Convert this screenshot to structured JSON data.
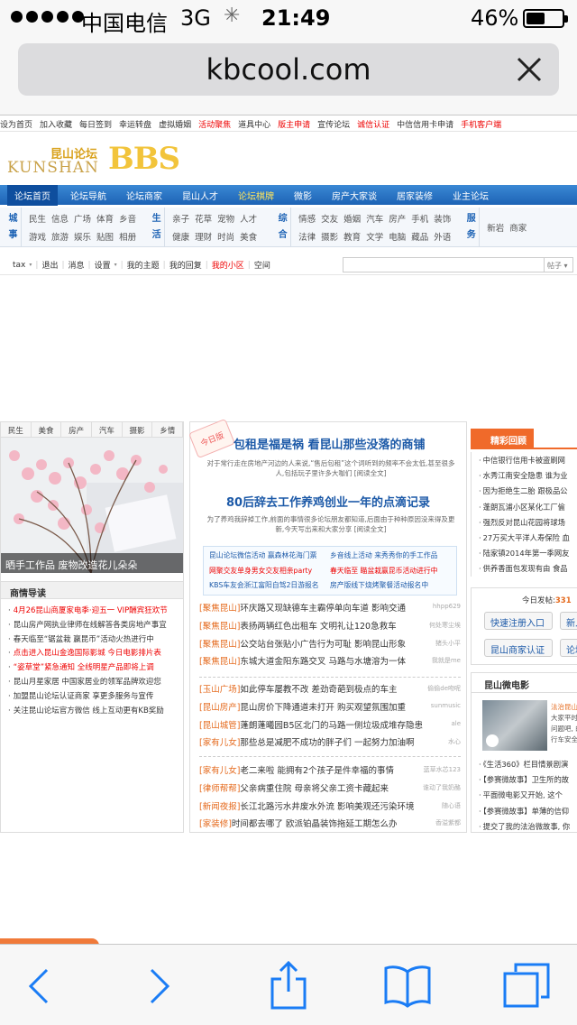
{
  "status": {
    "carrier": "中国电信",
    "network": "3G",
    "time": "21:49",
    "battery": "46%"
  },
  "browser": {
    "url": "kbcool.com"
  },
  "top_links": [
    {
      "t": "设为首页",
      "red": false
    },
    {
      "t": "加入收藏",
      "red": false
    },
    {
      "t": "每日签到",
      "red": false
    },
    {
      "t": "幸运转盘",
      "red": false
    },
    {
      "t": "虚拟婚姻",
      "red": false
    },
    {
      "t": "活动聚焦",
      "red": true
    },
    {
      "t": "道具中心",
      "red": false
    },
    {
      "t": "版主申请",
      "red": true
    },
    {
      "t": "宣传论坛",
      "red": false
    },
    {
      "t": "诚信认证",
      "red": true
    },
    {
      "t": "中信信用卡申请",
      "red": false
    },
    {
      "t": "手机客户端",
      "red": true
    }
  ],
  "logo": {
    "cn": "昆山论坛",
    "en": "KUNSHAN",
    "bbs": "BBS"
  },
  "main_nav": [
    {
      "t": "论坛首页",
      "cls": "first"
    },
    {
      "t": "论坛导航",
      "cls": ""
    },
    {
      "t": "论坛商家",
      "cls": ""
    },
    {
      "t": "昆山人才",
      "cls": ""
    },
    {
      "t": "论坛棋牌",
      "cls": "yel"
    },
    {
      "t": "微影",
      "cls": ""
    },
    {
      "t": "房产大家谈",
      "cls": ""
    },
    {
      "t": "居家装修",
      "cls": ""
    },
    {
      "t": "业主论坛",
      "cls": ""
    }
  ],
  "categories": [
    {
      "head1": "城",
      "head2": "事",
      "links": [
        "民生",
        "信息",
        "广场",
        "体育",
        "乡音",
        "游戏",
        "旅游",
        "娱乐",
        "贴图",
        "相册"
      ]
    },
    {
      "head1": "生",
      "head2": "活",
      "links": [
        "亲子",
        "花草",
        "宠物",
        "人才",
        "",
        "健康",
        "理财",
        "时尚",
        "美食",
        ""
      ]
    },
    {
      "head1": "综",
      "head2": "合",
      "links": [
        "情感",
        "交友",
        "婚姻",
        "汽车",
        "房产",
        "手机",
        "装饰",
        "法律",
        "摄影",
        "教育",
        "文学",
        "电脑",
        "藏品",
        "外语"
      ]
    },
    {
      "head1": "服",
      "head2": "务",
      "links": [
        "新岩",
        "商家"
      ]
    }
  ],
  "user_bar": {
    "items": [
      "tax",
      "退出",
      "消息",
      "设置",
      "我的主题",
      "我的回复",
      "我的小区",
      "空间"
    ],
    "search_btn": "帖子"
  },
  "left": {
    "tabs": [
      "民生",
      "美食",
      "房产",
      "汽车",
      "摄影",
      "乡情"
    ],
    "photo_caption": "晒手工作品 废物改造花儿朵朵",
    "section": "商情导读",
    "items": [
      {
        "t": "4月26昆山商厦家电季·迎五一 VIP酬宾狂欢节",
        "red": true
      },
      {
        "t": "昆山房产网执业律师在线解答各类房地产事宜",
        "red": false
      },
      {
        "t": "春天临至“锯盆栽 赢昆币”活动火热进行中",
        "red": false
      },
      {
        "t": "点击进入昆山金逸国际影城 今日电影排片表",
        "red": true
      },
      {
        "t": "“姿草堂”紧急通知 全线明星产品即将上调",
        "red": true
      },
      {
        "t": "昆山月星家居 中国家居业的领军品牌欢迎您",
        "red": false
      },
      {
        "t": "加盟昆山论坛认证商家 享更多服务与宣传",
        "red": false
      },
      {
        "t": "关注昆山论坛官方微信 线上互动更有KB奖励",
        "red": false
      }
    ]
  },
  "center": {
    "badge": "今日版",
    "headline1": "包租是福是祸 看昆山那些没落的商铺",
    "summary1": "对于常行走在房地产河边的人来说,“售后包租”这个词听到的频率不会太低,甚至很多人,包括玩子里许多大咖们 [阅读全文]",
    "headline2": "80后辞去工作养鸡创业一年的点滴记录",
    "summary2": "为了养鸡我辞掉工作,前面的事情很多论坛朋友都知道,后面由于种种原因没来得及更新,今天写出来和大家分享 [阅读全文]",
    "links": [
      {
        "t": "昆山论坛微信活动 赢森林花海门票",
        "c": "b"
      },
      {
        "t": "乡音线上活动 来秀秀你的手工作品",
        "c": "b"
      },
      {
        "t": "网聚交友单身男女交友相亲party",
        "c": "r"
      },
      {
        "t": "春天临至 瞄盆栽赢昆币活动进行中",
        "c": "r"
      },
      {
        "t": "KBS车友会浙江富阳自驾2日游报名",
        "c": "b"
      },
      {
        "t": "房产版线下烧烤聚餐活动报名中",
        "c": "b"
      }
    ],
    "news1": [
      {
        "tag": "[聚焦昆山]",
        "t": "环庆路又现缺德车主霸停单向车道 影响交通",
        "au": "hhpp629"
      },
      {
        "tag": "[聚焦昆山]",
        "t": "表扬两辆红色出租车 文明礼让120急救车",
        "au": "何处寒尘埃"
      },
      {
        "tag": "[聚焦昆山]",
        "t": "公交站台张贴小广告行为可耻 影响昆山形象",
        "au": "猪头小平"
      },
      {
        "tag": "[聚焦昆山]",
        "t": "东城大道金阳东路交叉 马路与水塘溶为一体",
        "au": "我就是me"
      }
    ],
    "news2": [
      {
        "tag": "[玉山广场]",
        "t": "如此停车屡教不改 差劲奇葩到极点的车主",
        "au": "偷偷de吻呢"
      },
      {
        "tag": "[昆山房产]",
        "t": "昆山房价下降通道未打开 购买观望氛围加重",
        "au": "sunmusic"
      },
      {
        "tag": "[昆山城管]",
        "t": "蓬朗蓬曦园B5区北门的马路一侧垃圾成堆存隐患",
        "au": "ale"
      },
      {
        "tag": "[家有儿女]",
        "t": "那些总是减肥不成功的胖子们 一起努力加油啊",
        "au": "水心"
      }
    ],
    "news3": [
      {
        "tag": "[家有儿女]",
        "t": "老二来啦 能拥有2个孩子是件幸福的事情",
        "au": "蓝草水芯123"
      },
      {
        "tag": "[律师帮帮]",
        "t": "父亲病重住院 母亲将父亲工资卡藏起来",
        "au": "谁动了我奶酪"
      },
      {
        "tag": "[新闻夜报]",
        "t": "长江北路污水井废水外流 影响美观还污染环境",
        "au": "随心语"
      },
      {
        "tag": "[家装修]",
        "t": "时间都去哪了 欧派铂晶装饰拖延工期怎么办",
        "au": "香溢紫都"
      }
    ]
  },
  "right": {
    "hot_title": "精彩回顾",
    "hot_items": [
      "中信银行信用卡被盗刷网",
      "水秀江南安全隐患 谁为业",
      "因为拒绝生二胎 跟极品公",
      "蓬朗瓦浦小区某化工厂偷",
      "强烈反对昆山花园将球场",
      "27万买大平洋人寿保险 血",
      "陆家镇2014年第一季网友",
      "供养香面包发现有由 食品"
    ],
    "today_label": "今日发帖:",
    "today_count": "331",
    "btn_register": "快速注册入口",
    "btn_new": "新人",
    "btn_merchant": "昆山商家认证",
    "btn_forum": "论坛",
    "micro_title": "昆山微电影",
    "micro_text_title": "法治昆山",
    "micro_text": "大家平时... 问题吧, 的行车安全...",
    "micro_items": [
      "《生活360》栏目情景剧演",
      "【参赛微故事】卫生所的故",
      "平面微电影又开始, 这个",
      "【参赛微故事】单薄的信仰",
      "提交了我的法治微故事, 你"
    ]
  }
}
